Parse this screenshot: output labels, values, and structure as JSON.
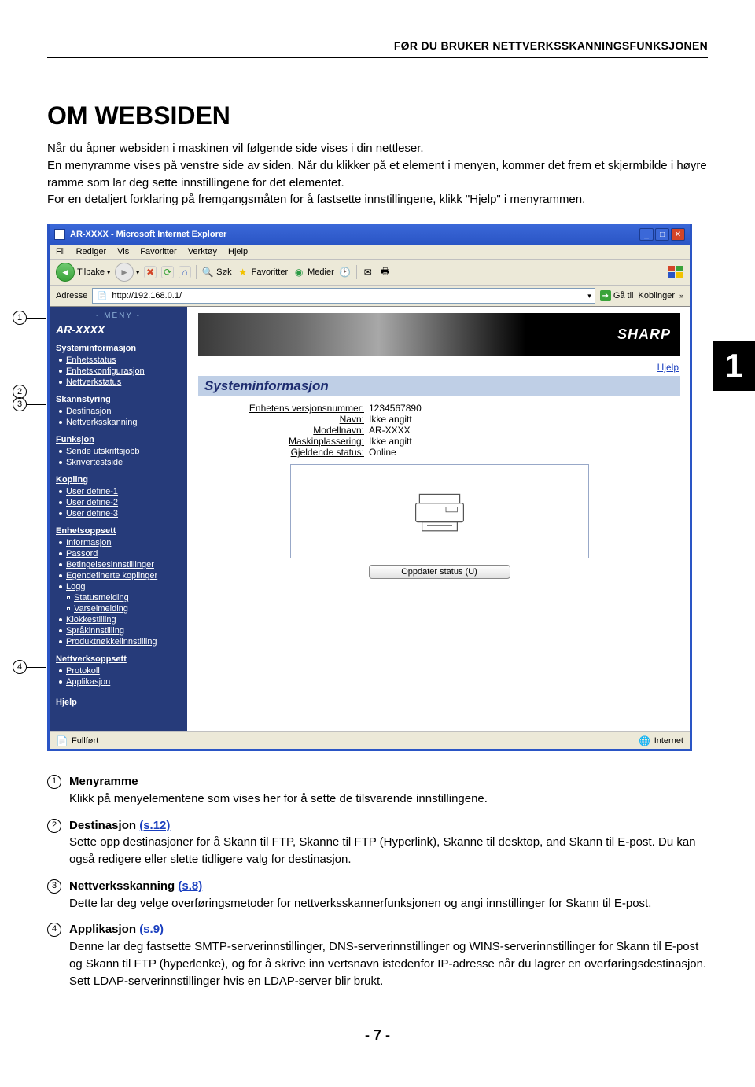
{
  "running_head": "FØR DU BRUKER NETTVERKSSKANNINGSFUNKSJONEN",
  "title": "OM WEBSIDEN",
  "intro": "Når du åpner websiden i maskinen vil følgende side vises i din nettleser.\nEn menyramme vises på venstre side av siden. Når du klikker på et element i menyen, kommer det frem et skjermbilde i høyre ramme som lar deg sette innstillingene for det elementet.\nFor en detaljert forklaring på fremgangsmåten for å fastsette innstillingene, klikk \"Hjelp\" i menyrammen.",
  "side_tab": "1",
  "callouts": [
    "1",
    "2",
    "3",
    "4"
  ],
  "browser": {
    "title": "AR-XXXX - Microsoft Internet Explorer",
    "menu": [
      "Fil",
      "Rediger",
      "Vis",
      "Favoritter",
      "Verktøy",
      "Hjelp"
    ],
    "back": "Tilbake",
    "search": "Søk",
    "favorites": "Favoritter",
    "media": "Medier",
    "addr_label": "Adresse",
    "addr_value": "http://192.168.0.1/",
    "go": "Gå til",
    "links": "Koblinger",
    "status_left": "Fullført",
    "status_right": "Internet"
  },
  "sidebar": {
    "head": "- MENY -",
    "model": "AR-XXXX",
    "groups": [
      {
        "title": "Systeminformasjon",
        "items": [
          "Enhetsstatus",
          "Enhetskonfigurasjon",
          "Nettverkstatus"
        ]
      },
      {
        "title": "Skannstyring",
        "items": [
          "Destinasjon",
          "Nettverksskanning"
        ]
      },
      {
        "title": "Funksjon",
        "items": [
          "Sende utskriftsjobb",
          "Skrivertestside"
        ]
      },
      {
        "title": "Kopling",
        "items": [
          "User define-1",
          "User define-2",
          "User define-3"
        ]
      },
      {
        "title": "Enhetsoppsett",
        "items": [
          "Informasjon",
          "Passord",
          "Betingelsesinnstillinger",
          "Egendefinerte koplinger",
          "Logg"
        ],
        "sub": [
          "Statusmelding",
          "Varselmelding"
        ],
        "after": [
          "Klokkestilling",
          "Språkinnstilling",
          "Produktnøkkelinnstilling"
        ]
      },
      {
        "title": "Nettverksoppsett",
        "items": [
          "Protokoll",
          "Applikasjon"
        ]
      }
    ],
    "help": "Hjelp"
  },
  "content": {
    "logo": "SHARP",
    "help_link": "Hjelp",
    "section": "Systeminformasjon",
    "rows": [
      {
        "label": "Enhetens versjonsnummer:",
        "value": "1234567890"
      },
      {
        "label": "Navn:",
        "value": "Ikke angitt"
      },
      {
        "label": "Modellnavn:",
        "value": "AR-XXXX"
      },
      {
        "label": "Maskinplassering:",
        "value": "Ikke angitt"
      },
      {
        "label": "Gjeldende status:",
        "value": "Online"
      }
    ],
    "update_btn": "Oppdater status (U)"
  },
  "legend": [
    {
      "num": "1",
      "title": "Menyramme",
      "desc": "Klikk på menyelementene som vises her for å sette de tilsvarende innstillingene."
    },
    {
      "num": "2",
      "title": "Destinasjon",
      "link": "(s.12)",
      "desc": "Sette opp destinasjoner for å Skann til FTP, Skanne til FTP (Hyperlink), Skanne til desktop, and Skann til E-post. Du kan også redigere eller slette tidligere valg for destinasjon."
    },
    {
      "num": "3",
      "title": "Nettverksskanning",
      "link": "(s.8)",
      "desc": "Dette lar deg velge overføringsmetoder for nettverksskannerfunksjonen og angi innstillinger for Skann til E-post."
    },
    {
      "num": "4",
      "title": "Applikasjon",
      "link": "(s.9)",
      "desc": "Denne lar deg fastsette SMTP-serverinnstillinger, DNS-serverinnstillinger og WINS-serverinnstillinger for Skann til E-post og Skann til FTP (hyperlenke), og for å skrive inn vertsnavn istedenfor IP-adresse når du lagrer en overføringsdestinasjon.\nSett LDAP-serverinnstillinger hvis en LDAP-server blir brukt."
    }
  ],
  "footer": "- 7 -"
}
